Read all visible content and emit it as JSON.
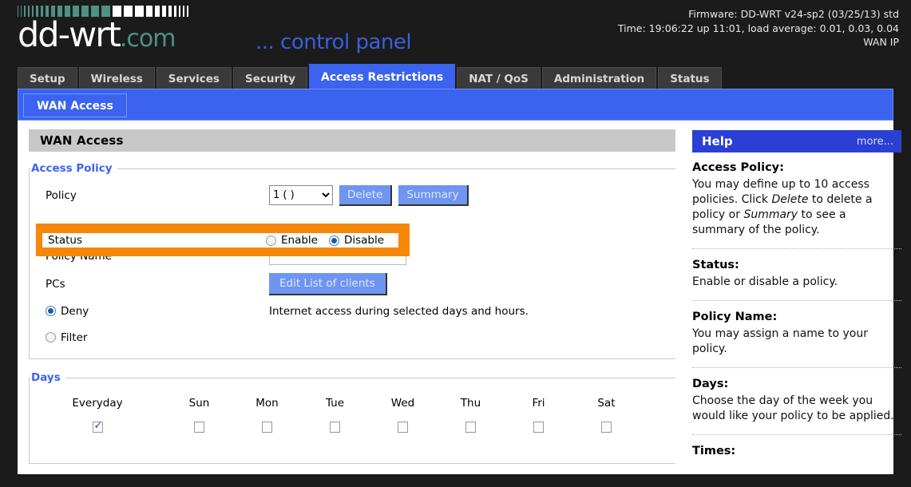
{
  "header": {
    "logo_main": "dd-wrt",
    "logo_suffix": ".com",
    "control_panel": "... control panel",
    "firmware": "Firmware: DD-WRT v24-sp2 (03/25/13) std",
    "time": "Time: 19:06:22 up 11:01, load average: 0.01, 0.03, 0.04",
    "wan_ip": "WAN IP"
  },
  "tabs": [
    {
      "label": "Setup",
      "active": false
    },
    {
      "label": "Wireless",
      "active": false
    },
    {
      "label": "Services",
      "active": false
    },
    {
      "label": "Security",
      "active": false
    },
    {
      "label": "Access Restrictions",
      "active": true
    },
    {
      "label": "NAT / QoS",
      "active": false
    },
    {
      "label": "Administration",
      "active": false
    },
    {
      "label": "Status",
      "active": false
    }
  ],
  "subnav": {
    "active_tab": "WAN Access"
  },
  "main": {
    "section_title": "WAN Access",
    "access_policy": {
      "legend": "Access Policy",
      "policy_label": "Policy",
      "policy_value": "1 ( )",
      "policy_options": [
        "1 ( )"
      ],
      "delete_label": "Delete",
      "summary_label": "Summary",
      "status_label": "Status",
      "status_enable_label": "Enable",
      "status_disable_label": "Disable",
      "status_selected": "Disable",
      "policy_name_label": "Policy Name",
      "policy_name_value": "",
      "policy_name_placeholder": "",
      "pcs_label": "PCs",
      "edit_clients_label": "Edit List of clients",
      "deny_label": "Deny",
      "filter_label": "Filter",
      "mode_selected": "Deny",
      "deny_note": "Internet access during selected days and hours."
    },
    "days": {
      "legend": "Days",
      "columns": [
        {
          "label": "Everyday",
          "checked": true
        },
        {
          "label": "Sun",
          "checked": false
        },
        {
          "label": "Mon",
          "checked": false
        },
        {
          "label": "Tue",
          "checked": false
        },
        {
          "label": "Wed",
          "checked": false
        },
        {
          "label": "Thu",
          "checked": false
        },
        {
          "label": "Fri",
          "checked": false
        },
        {
          "label": "Sat",
          "checked": false
        }
      ]
    }
  },
  "help": {
    "title": "Help",
    "more_label": "more...",
    "entries": [
      {
        "term": "Access Policy:",
        "desc_parts": [
          {
            "text": "You may define up to 10 access policies. Click ",
            "italic": false
          },
          {
            "text": "Delete",
            "italic": true
          },
          {
            "text": " to delete a policy or ",
            "italic": false
          },
          {
            "text": "Summary",
            "italic": true
          },
          {
            "text": " to see a summary of the policy.",
            "italic": false
          }
        ]
      },
      {
        "term": "Status:",
        "desc_parts": [
          {
            "text": "Enable or disable a policy.",
            "italic": false
          }
        ]
      },
      {
        "term": "Policy Name:",
        "desc_parts": [
          {
            "text": "You may assign a name to your policy.",
            "italic": false
          }
        ]
      },
      {
        "term": "Days:",
        "desc_parts": [
          {
            "text": "Choose the day of the week you would like your policy to be applied.",
            "italic": false
          }
        ]
      },
      {
        "term": "Times:",
        "desc_parts": []
      }
    ]
  },
  "colors": {
    "accent_blue": "#3b63f0",
    "highlight_orange": "#f5880b",
    "logo_teal": "#4e9182",
    "header_bg": "#1b1b1b"
  }
}
